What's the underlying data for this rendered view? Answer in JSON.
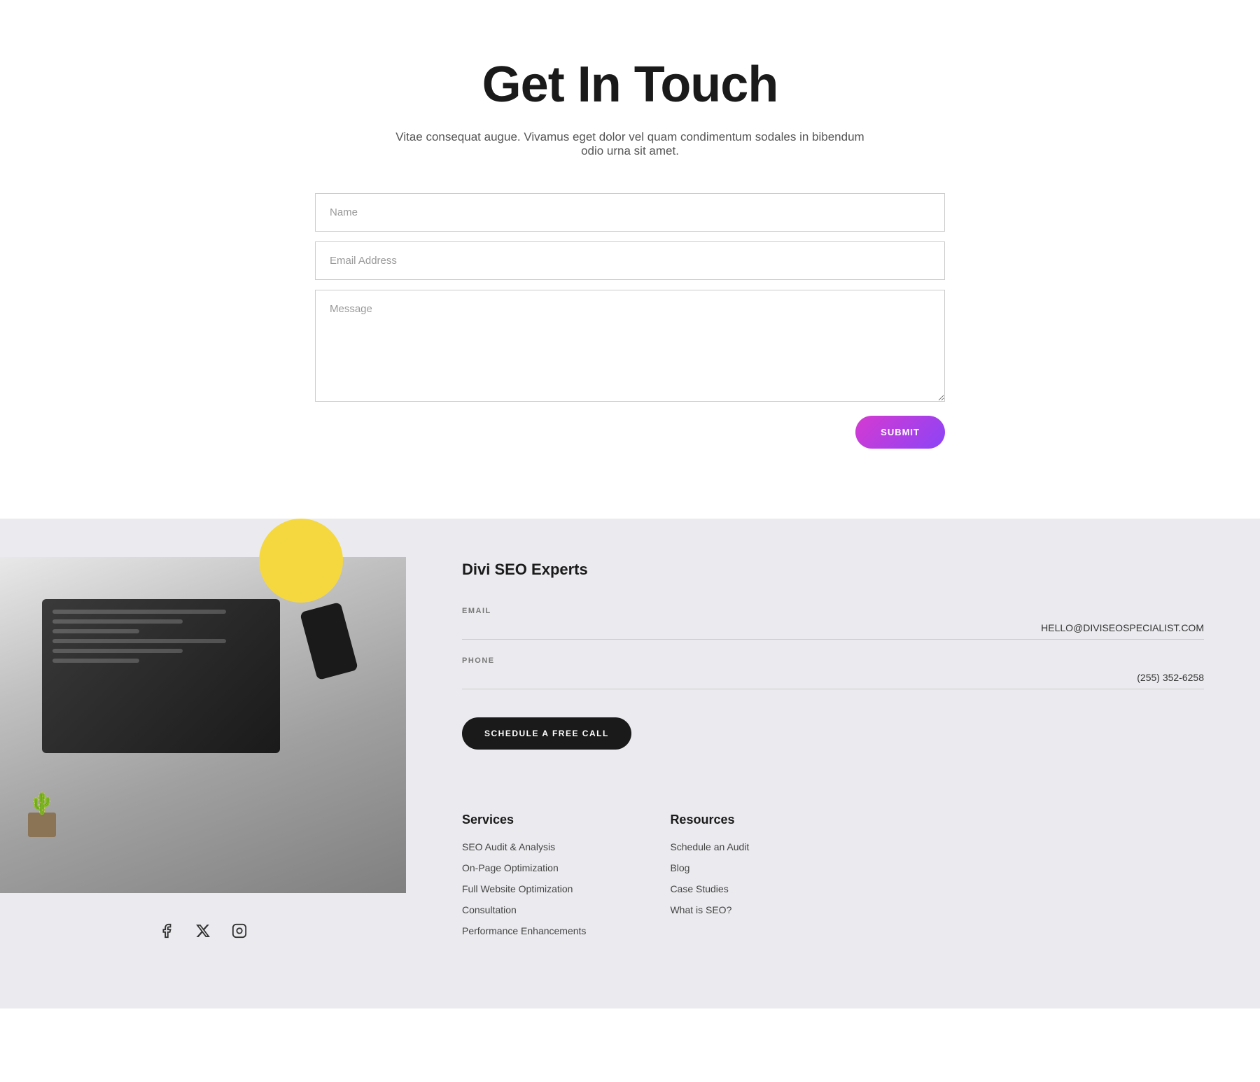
{
  "contact": {
    "title": "Get In Touch",
    "subtitle": "Vitae consequat augue. Vivamus eget dolor vel quam condimentum sodales in bibendum odio urna sit amet.",
    "form": {
      "name_placeholder": "Name",
      "email_placeholder": "Email Address",
      "message_placeholder": "Message",
      "submit_label": "SUBMIT"
    }
  },
  "footer": {
    "company_name": "Divi SEO Experts",
    "email_label": "EMAIL",
    "email_value": "HELLO@DIVISEOSPECIALIST.COM",
    "phone_label": "PHONE",
    "phone_value": "(255) 352-6258",
    "schedule_btn_label": "SCHEDULE A FREE CALL",
    "services": {
      "heading": "Services",
      "items": [
        "SEO Audit & Analysis",
        "On-Page Optimization",
        "Full Website Optimization",
        "Consultation",
        "Performance Enhancements"
      ]
    },
    "resources": {
      "heading": "Resources",
      "items": [
        "Schedule an Audit",
        "Blog",
        "Case Studies",
        "What is SEO?"
      ]
    }
  }
}
